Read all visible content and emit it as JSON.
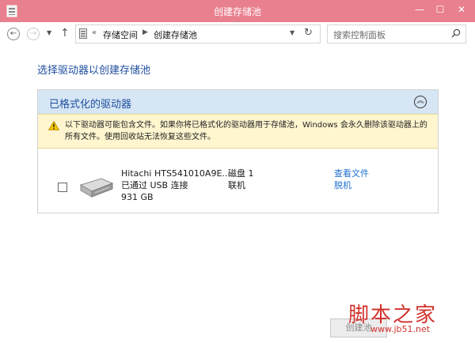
{
  "window": {
    "title": "创建存储池",
    "min_glyph": "—",
    "max_glyph": "☐",
    "close_glyph": "✕"
  },
  "nav": {
    "back_glyph": "←",
    "forward_glyph": "→",
    "recent_glyph": "▼",
    "up_glyph": "↑",
    "crumb_sep": "«",
    "crumb_arrow": "▶",
    "breadcrumb": [
      "存储空间",
      "创建存储池"
    ],
    "dropdown_glyph": "▼",
    "refresh_glyph": "↻",
    "search_placeholder": "搜索控制面板"
  },
  "content": {
    "heading": "选择驱动器以创建存储池",
    "section_title": "已格式化的驱动器",
    "collapse_glyph": "︽",
    "warning_text": "以下驱动器可能包含文件。如果你将已格式化的驱动器用于存储池，Windows 会永久删除该驱动器上的所有文件。使用回收站无法恢复这些文件。",
    "drive": {
      "name": "Hitachi HTS541010A9E...",
      "connection": "已通过 USB 连接",
      "size": "931 GB",
      "disk": "磁盘 1",
      "status": "联机",
      "view_files": "查看文件",
      "offline": "脱机"
    }
  },
  "footer": {
    "create_button": "创建池"
  },
  "watermark": {
    "text": "脚本之家",
    "url": "www.jb51.net"
  }
}
